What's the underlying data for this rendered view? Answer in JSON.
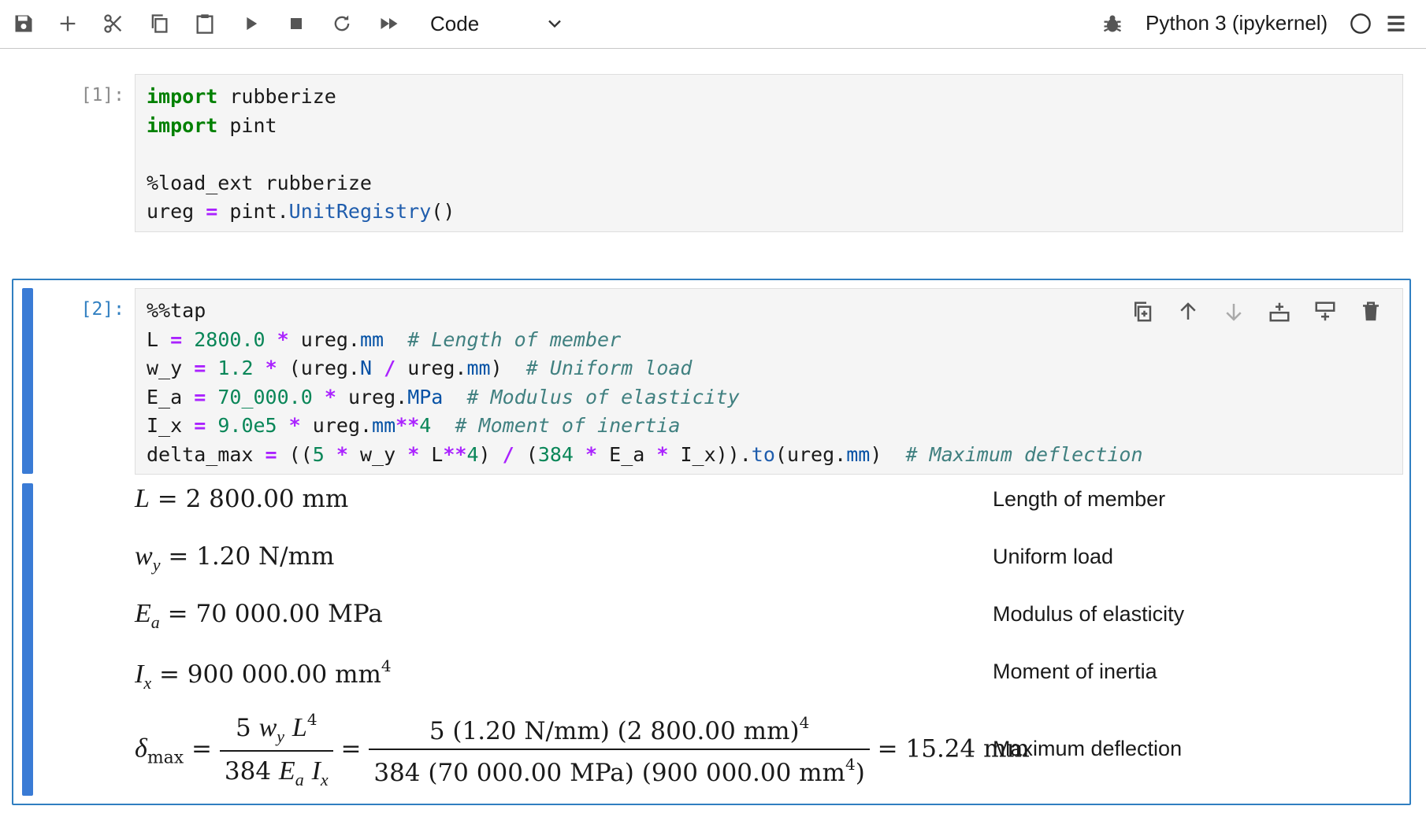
{
  "toolbar": {
    "cell_type": "Code",
    "kernel_name": "Python 3 (ipykernel)"
  },
  "cells": [
    {
      "prompt": "[1]:",
      "lines": [
        [
          {
            "t": "import",
            "c": "kw"
          },
          {
            "t": " rubberize"
          }
        ],
        [
          {
            "t": "import",
            "c": "kw"
          },
          {
            "t": " pint"
          }
        ],
        [
          {
            "t": ""
          }
        ],
        [
          {
            "t": "%load_ext rubberize"
          }
        ],
        [
          {
            "t": "ureg "
          },
          {
            "t": "=",
            "c": "op"
          },
          {
            "t": " pint."
          },
          {
            "t": "UnitRegistry",
            "c": "fn"
          },
          {
            "t": "()"
          }
        ]
      ]
    },
    {
      "prompt": "[2]:",
      "lines": [
        [
          {
            "t": "%%tap"
          }
        ],
        [
          {
            "t": "L "
          },
          {
            "t": "=",
            "c": "op"
          },
          {
            "t": " "
          },
          {
            "t": "2800.0",
            "c": "num"
          },
          {
            "t": " "
          },
          {
            "t": "*",
            "c": "op"
          },
          {
            "t": " ureg."
          },
          {
            "t": "mm",
            "c": "attr"
          },
          {
            "t": "  "
          },
          {
            "t": "# Length of member",
            "c": "cm"
          }
        ],
        [
          {
            "t": "w_y "
          },
          {
            "t": "=",
            "c": "op"
          },
          {
            "t": " "
          },
          {
            "t": "1.2",
            "c": "num"
          },
          {
            "t": " "
          },
          {
            "t": "*",
            "c": "op"
          },
          {
            "t": " (ureg."
          },
          {
            "t": "N",
            "c": "attr"
          },
          {
            "t": " "
          },
          {
            "t": "/",
            "c": "op"
          },
          {
            "t": " ureg."
          },
          {
            "t": "mm",
            "c": "attr"
          },
          {
            "t": ")  "
          },
          {
            "t": "# Uniform load",
            "c": "cm"
          }
        ],
        [
          {
            "t": "E_a "
          },
          {
            "t": "=",
            "c": "op"
          },
          {
            "t": " "
          },
          {
            "t": "70_000.0",
            "c": "num"
          },
          {
            "t": " "
          },
          {
            "t": "*",
            "c": "op"
          },
          {
            "t": " ureg."
          },
          {
            "t": "MPa",
            "c": "attr"
          },
          {
            "t": "  "
          },
          {
            "t": "# Modulus of elasticity",
            "c": "cm"
          }
        ],
        [
          {
            "t": "I_x "
          },
          {
            "t": "=",
            "c": "op"
          },
          {
            "t": " "
          },
          {
            "t": "9.0e5",
            "c": "num"
          },
          {
            "t": " "
          },
          {
            "t": "*",
            "c": "op"
          },
          {
            "t": " ureg."
          },
          {
            "t": "mm",
            "c": "attr"
          },
          {
            "t": "**",
            "c": "op"
          },
          {
            "t": "4",
            "c": "num"
          },
          {
            "t": "  "
          },
          {
            "t": "# Moment of inertia",
            "c": "cm"
          }
        ],
        [
          {
            "t": "delta_max "
          },
          {
            "t": "=",
            "c": "op"
          },
          {
            "t": " (("
          },
          {
            "t": "5",
            "c": "num"
          },
          {
            "t": " "
          },
          {
            "t": "*",
            "c": "op"
          },
          {
            "t": " w_y "
          },
          {
            "t": "*",
            "c": "op"
          },
          {
            "t": " L"
          },
          {
            "t": "**",
            "c": "op"
          },
          {
            "t": "4",
            "c": "num"
          },
          {
            "t": ") "
          },
          {
            "t": "/",
            "c": "op"
          },
          {
            "t": " ("
          },
          {
            "t": "384",
            "c": "num"
          },
          {
            "t": " "
          },
          {
            "t": "*",
            "c": "op"
          },
          {
            "t": " E_a "
          },
          {
            "t": "*",
            "c": "op"
          },
          {
            "t": " I_x))."
          },
          {
            "t": "to",
            "c": "fn"
          },
          {
            "t": "(ureg."
          },
          {
            "t": "mm",
            "c": "attr"
          },
          {
            "t": ")  "
          },
          {
            "t": "# Maximum deflection",
            "c": "cm"
          }
        ]
      ]
    }
  ],
  "output": {
    "L": {
      "sym": "L",
      "value": "= 2 800.00 mm",
      "desc": "Length of member"
    },
    "w_y": {
      "sym": "w",
      "sub": "y",
      "value": "= 1.20 N/mm",
      "desc": "Uniform load"
    },
    "E_a": {
      "sym": "E",
      "sub": "a",
      "value": "= 70 000.00 MPa",
      "desc": "Modulus of elasticity"
    },
    "I_x": {
      "sym": "I",
      "sub": "x",
      "value": "= 900 000.00 mm",
      "sup": "4",
      "desc": "Moment of inertia"
    },
    "delta": {
      "sym": "δ",
      "sub": "max",
      "num_coef": "5",
      "num_w": "w",
      "num_w_sub": "y",
      "num_L": "L",
      "num_L_sup": "4",
      "den_coef": "384",
      "den_E": "E",
      "den_E_sub": "a",
      "den_I": "I",
      "den_I_sub": "x",
      "sub_num": "5 (1.20 N/mm) (2 800.00 mm)",
      "sub_num_sup": "4",
      "sub_den": "384 (70 000.00 MPa) (900 000.00 mm",
      "sub_den_sup": "4",
      "sub_den_close": ")",
      "result": "= 15.24 mm",
      "desc": "Maximum deflection"
    }
  }
}
